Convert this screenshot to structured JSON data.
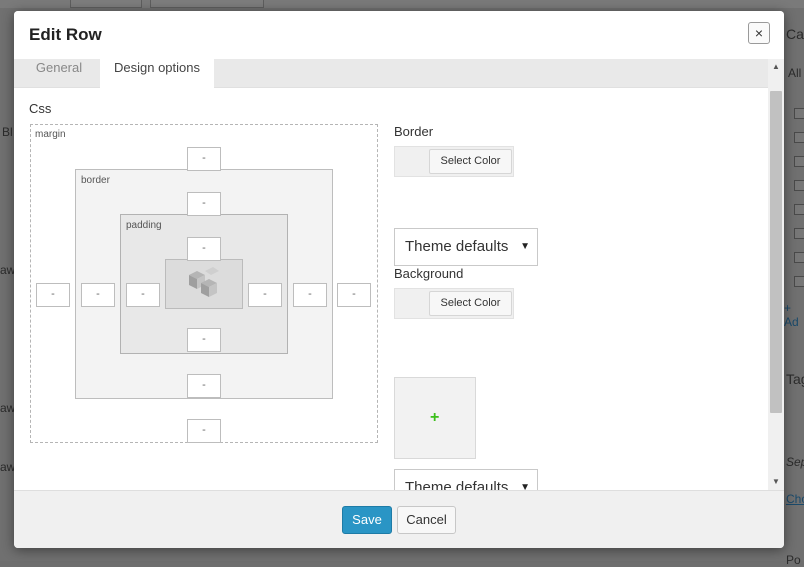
{
  "modal": {
    "title": "Edit Row",
    "close_label": "×",
    "tabs": [
      {
        "label": "General",
        "active": false
      },
      {
        "label": "Design options",
        "active": true
      }
    ]
  },
  "css_section": {
    "label": "Css",
    "margin_label": "margin",
    "border_label": "border",
    "padding_label": "padding",
    "fields": {
      "margin_top": "-",
      "margin_right": "-",
      "margin_bottom": "-",
      "margin_left": "-",
      "border_top": "-",
      "border_right": "-",
      "border_bottom": "-",
      "border_left": "-",
      "padding_top": "-",
      "padding_right": "-",
      "padding_bottom": "-",
      "padding_left": "-"
    }
  },
  "border": {
    "label": "Border",
    "color_button": "Select Color",
    "style_select": "Theme defaults"
  },
  "background": {
    "label": "Background",
    "color_button": "Select Color",
    "add_image": "+",
    "style_select": "Theme defaults"
  },
  "footer": {
    "save_label": "Save",
    "cancel_label": "Cancel"
  },
  "scrollbar": {
    "up": "▲",
    "down": "▼"
  },
  "colors": {
    "accent": "#2a95c5",
    "add_icon": "#3bbf1a",
    "select_arrow": "▼"
  },
  "backdrop_fragments": {
    "cat": "Cat",
    "all": "All",
    "bl": "Bl",
    "aw1": "aw",
    "aw2": "aw",
    "aw3": "aw",
    "ad": "+ Ad",
    "tag": "Tag",
    "sep": "Sep",
    "cho": "Cho",
    "po": "Po"
  }
}
